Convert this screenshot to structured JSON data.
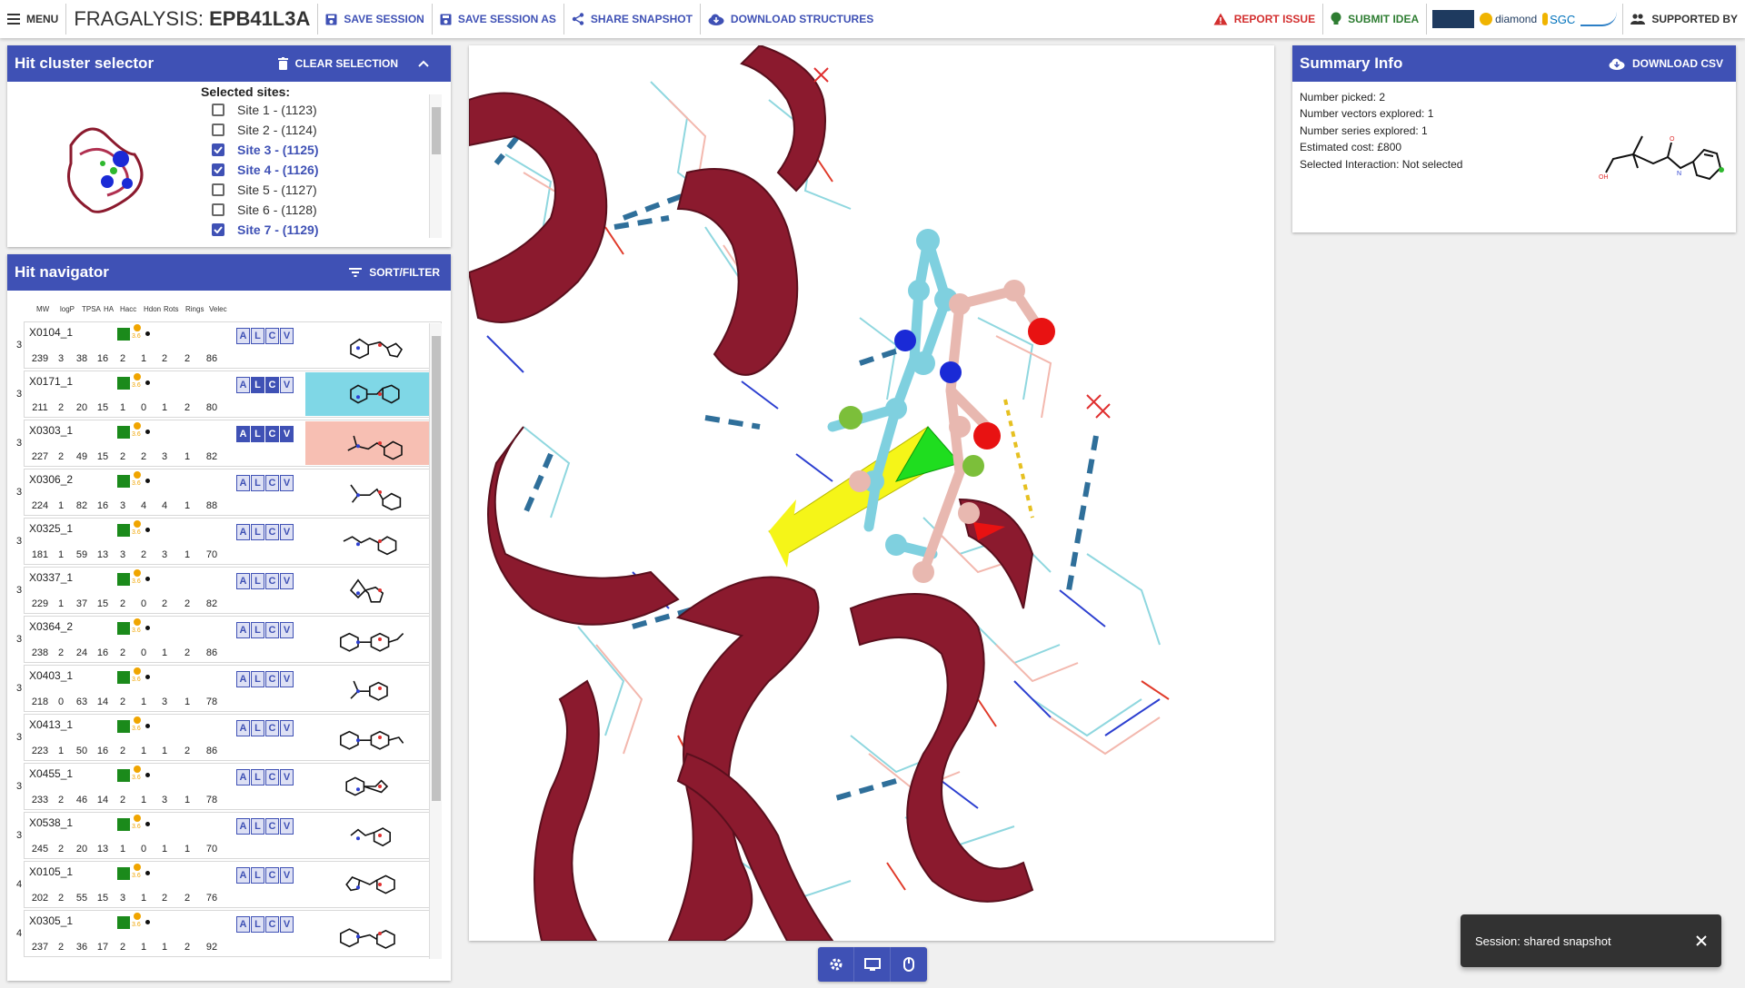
{
  "topbar": {
    "menu_label": "Menu",
    "app_name": "FRAGALYSIS: ",
    "target": "EPB41L3A",
    "save_session": "Save Session",
    "save_session_as": "Save Session As",
    "share_snapshot": "Share Snapshot",
    "download_structures": "Download Structures",
    "report_issue": "Report Issue",
    "submit_idea": "Submit Idea",
    "logo_diamond": "diamond",
    "logo_sgc": "SGC",
    "supported_by": "Supported By"
  },
  "cluster_selector": {
    "title": "Hit cluster selector",
    "clear_selection": "Clear selection",
    "sites_label": "Selected sites:",
    "sites": [
      {
        "label": "Site 1 - (1123)",
        "checked": false
      },
      {
        "label": "Site 2 - (1124)",
        "checked": false
      },
      {
        "label": "Site 3 - (1125)",
        "checked": true
      },
      {
        "label": "Site 4 - (1126)",
        "checked": true
      },
      {
        "label": "Site 5 - (1127)",
        "checked": false
      },
      {
        "label": "Site 6 - (1128)",
        "checked": false
      },
      {
        "label": "Site 7 - (1129)",
        "checked": true
      }
    ]
  },
  "hit_navigator": {
    "title": "Hit navigator",
    "sort_filter": "Sort/filter",
    "columns": [
      "MW",
      "logP",
      "TPSA",
      "HA",
      "Hacc",
      "Hdon",
      "Rots",
      "Rings",
      "Velec"
    ],
    "score_digit": "3.6",
    "alcv_letters": [
      "A",
      "L",
      "C",
      "V"
    ],
    "rows": [
      {
        "group": "3",
        "name": "X0104_1",
        "stats": [
          "239",
          "3",
          "38",
          "16",
          "2",
          "1",
          "2",
          "2",
          "86"
        ],
        "alcv": [
          false,
          false,
          false,
          false
        ],
        "highlight": ""
      },
      {
        "group": "3",
        "name": "X0171_1",
        "stats": [
          "211",
          "2",
          "20",
          "15",
          "1",
          "0",
          "1",
          "2",
          "80"
        ],
        "alcv": [
          false,
          true,
          true,
          false
        ],
        "highlight": "#7fd7e6"
      },
      {
        "group": "3",
        "name": "X0303_1",
        "stats": [
          "227",
          "2",
          "49",
          "15",
          "2",
          "2",
          "3",
          "1",
          "82"
        ],
        "alcv": [
          true,
          true,
          true,
          true
        ],
        "highlight": "#f7bfb3"
      },
      {
        "group": "3",
        "name": "X0306_2",
        "stats": [
          "224",
          "1",
          "82",
          "16",
          "3",
          "4",
          "4",
          "1",
          "88"
        ],
        "alcv": [
          false,
          false,
          false,
          false
        ],
        "highlight": ""
      },
      {
        "group": "3",
        "name": "X0325_1",
        "stats": [
          "181",
          "1",
          "59",
          "13",
          "3",
          "2",
          "3",
          "1",
          "70"
        ],
        "alcv": [
          false,
          false,
          false,
          false
        ],
        "highlight": ""
      },
      {
        "group": "3",
        "name": "X0337_1",
        "stats": [
          "229",
          "1",
          "37",
          "15",
          "2",
          "0",
          "2",
          "2",
          "82"
        ],
        "alcv": [
          false,
          false,
          false,
          false
        ],
        "highlight": ""
      },
      {
        "group": "3",
        "name": "X0364_2",
        "stats": [
          "238",
          "2",
          "24",
          "16",
          "2",
          "0",
          "1",
          "2",
          "86"
        ],
        "alcv": [
          false,
          false,
          false,
          false
        ],
        "highlight": ""
      },
      {
        "group": "3",
        "name": "X0403_1",
        "stats": [
          "218",
          "0",
          "63",
          "14",
          "2",
          "1",
          "3",
          "1",
          "78"
        ],
        "alcv": [
          false,
          false,
          false,
          false
        ],
        "highlight": ""
      },
      {
        "group": "3",
        "name": "X0413_1",
        "stats": [
          "223",
          "1",
          "50",
          "16",
          "2",
          "1",
          "1",
          "2",
          "86"
        ],
        "alcv": [
          false,
          false,
          false,
          false
        ],
        "highlight": ""
      },
      {
        "group": "3",
        "name": "X0455_1",
        "stats": [
          "233",
          "2",
          "46",
          "14",
          "2",
          "1",
          "3",
          "1",
          "78"
        ],
        "alcv": [
          false,
          false,
          false,
          false
        ],
        "highlight": ""
      },
      {
        "group": "3",
        "name": "X0538_1",
        "stats": [
          "245",
          "2",
          "20",
          "13",
          "1",
          "0",
          "1",
          "1",
          "70"
        ],
        "alcv": [
          false,
          false,
          false,
          false
        ],
        "highlight": ""
      },
      {
        "group": "4",
        "name": "X0105_1",
        "stats": [
          "202",
          "2",
          "55",
          "15",
          "3",
          "1",
          "2",
          "2",
          "76"
        ],
        "alcv": [
          false,
          false,
          false,
          false
        ],
        "highlight": ""
      },
      {
        "group": "4",
        "name": "X0305_1",
        "stats": [
          "237",
          "2",
          "36",
          "17",
          "2",
          "1",
          "1",
          "2",
          "92"
        ],
        "alcv": [
          false,
          false,
          false,
          false
        ],
        "highlight": ""
      }
    ]
  },
  "summary": {
    "title": "Summary Info",
    "download_csv": "Download CSV",
    "lines": [
      "Number picked: 2",
      "Number vectors explored: 1",
      "Number series explored: 1",
      "Estimated cost: £800",
      "Selected Interaction: Not selected"
    ]
  },
  "snackbar": {
    "message": "Session: shared snapshot"
  },
  "colors": {
    "primary": "#3f51b5",
    "ribbon": "#8b1a2e",
    "error": "#d32f2f"
  }
}
